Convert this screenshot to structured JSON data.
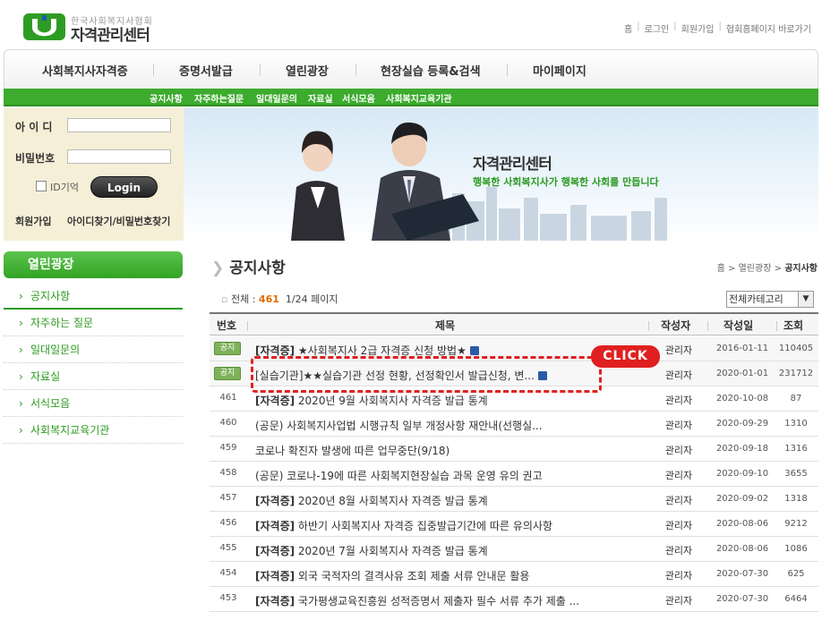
{
  "logo": {
    "sub": "한국사회복지사협회",
    "main": "자격관리센터"
  },
  "util_links": [
    "홈",
    "로그인",
    "회원가입",
    "협회홈페이지 바로가기"
  ],
  "gnb": [
    "사회복지사자격증",
    "증명서발급",
    "열린광장",
    "현장실습 등록&검색",
    "마이페이지"
  ],
  "subnav": [
    "공지사항",
    "자주하는질문",
    "일대일문의",
    "자료실",
    "서식모음",
    "사회복지교육기관"
  ],
  "login": {
    "id_label": "아 이 디",
    "pw_label": "비밀번호",
    "remember_label": "ID기억",
    "login_button": "Login",
    "join_link": "회원가입",
    "find_link": "아이디찾기/비밀번호찾기"
  },
  "banner": {
    "title": "자격관리센터",
    "slogan": "행복한 사회복지사가 행복한 사회를 만듭니다"
  },
  "left_menu": {
    "title": "열린광장",
    "items": [
      "공지사항",
      "자주하는 질문",
      "일대일문의",
      "자료실",
      "서식모음",
      "사회복지교육기관"
    ]
  },
  "page_title": "공지사항",
  "breadcrumb": {
    "home": "홈",
    "sep1": ">",
    "section": "열린광장",
    "sep2": ">",
    "current": "공지사항"
  },
  "total": {
    "label": "전체 :",
    "count": "461",
    "pages": "1/24 페이지"
  },
  "category_select": "전체카테고리",
  "table": {
    "headers": {
      "no": "번호",
      "title": "제목",
      "author": "작성자",
      "date": "작성일",
      "hits": "조회"
    },
    "rows": [
      {
        "no": "공지",
        "notice": true,
        "prefix": "[자격증]",
        "title": " ★사회복지사 2급 자격증 신청 방법★",
        "file": true,
        "author": "관리자",
        "date": "2016-01-11",
        "hits": "110405"
      },
      {
        "no": "공지",
        "notice": true,
        "prefix": "",
        "title": "[실습기관]★★실습기관 선정 현황, 선정확인서 발급신청, 변...",
        "file": true,
        "author": "관리자",
        "date": "2020-01-01",
        "hits": "231712"
      },
      {
        "no": "461",
        "notice": false,
        "prefix": "[자격증]",
        "title": " 2020년 9월 사회복지사 자격증 발급 통계",
        "file": false,
        "author": "관리자",
        "date": "2020-10-08",
        "hits": "87"
      },
      {
        "no": "460",
        "notice": false,
        "prefix": "",
        "title": "(공문) 사회복지사업법 시행규칙 일부 개정사항 재안내(선행실...",
        "file": false,
        "author": "관리자",
        "date": "2020-09-29",
        "hits": "1310"
      },
      {
        "no": "459",
        "notice": false,
        "prefix": "",
        "title": "코로나 확진자 발생에 따른 업무중단(9/18)",
        "file": false,
        "author": "관리자",
        "date": "2020-09-18",
        "hits": "1316"
      },
      {
        "no": "458",
        "notice": false,
        "prefix": "",
        "title": "(공문) 코로나-19에 따른 사회복지현장실습 과목 운영 유의 권고",
        "file": false,
        "author": "관리자",
        "date": "2020-09-10",
        "hits": "3655"
      },
      {
        "no": "457",
        "notice": false,
        "prefix": "[자격증]",
        "title": " 2020년 8월 사회복지사 자격증 발급 통계",
        "file": false,
        "author": "관리자",
        "date": "2020-09-02",
        "hits": "1318"
      },
      {
        "no": "456",
        "notice": false,
        "prefix": "[자격증]",
        "title": " 하반기 사회복지사 자격증 집중발급기간에 따른 유의사항",
        "file": false,
        "author": "관리자",
        "date": "2020-08-06",
        "hits": "9212"
      },
      {
        "no": "455",
        "notice": false,
        "prefix": "[자격증]",
        "title": " 2020년 7월 사회복지사 자격증 발급 통계",
        "file": false,
        "author": "관리자",
        "date": "2020-08-06",
        "hits": "1086"
      },
      {
        "no": "454",
        "notice": false,
        "prefix": "[자격증]",
        "title": " 외국 국적자의 결격사유 조회 제출 서류 안내문 활용",
        "file": false,
        "author": "관리자",
        "date": "2020-07-30",
        "hits": "625"
      },
      {
        "no": "453",
        "notice": false,
        "prefix": "[자격증]",
        "title": " 국가평생교육진흥원 성적증명서 제출자 필수 서류 추가 제출 ...",
        "file": false,
        "author": "관리자",
        "date": "2020-07-30",
        "hits": "6464"
      }
    ]
  },
  "annotation": {
    "label": "CLICK",
    "color": "#e02020"
  },
  "colors": {
    "brand_green": "#3cab2e",
    "accent_orange": "#e16a00"
  }
}
